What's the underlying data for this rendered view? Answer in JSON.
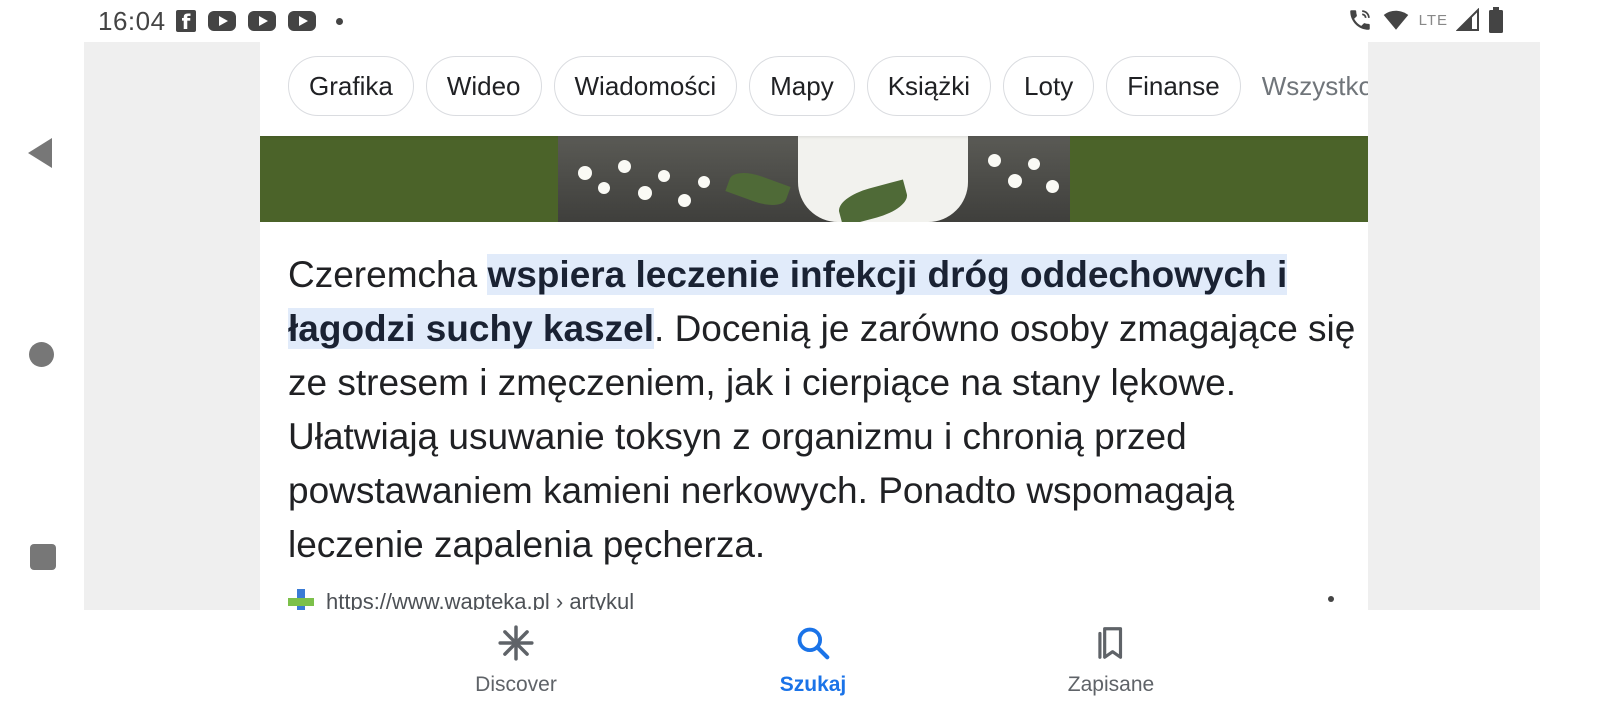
{
  "status_bar": {
    "time": "16:04",
    "left_icons": [
      "facebook-icon",
      "youtube-icon",
      "youtube-icon",
      "youtube-icon",
      "more-notifications-dot"
    ],
    "network_label": "LTE",
    "right_icons": [
      "wifi-calling-icon",
      "wifi-icon",
      "signal-icon",
      "battery-icon"
    ]
  },
  "search": {
    "chips": [
      "Grafika",
      "Wideo",
      "Wiadomości",
      "Mapy",
      "Książki",
      "Loty",
      "Finanse",
      "Wszystko"
    ]
  },
  "snippet": {
    "lead": "Czeremcha ",
    "highlight": "wspiera leczenie infekcji dróg oddechowych i łagodzi suchy kaszel",
    "rest": ". Docenią je zarówno osoby zmagające się ze stresem i zmęczeniem, jak i cierpiące na stany lękowe. Ułatwiają usuwanie toksyn z organizmu i chronią przed powstawaniem kamieni nerkowych. Ponadto wspomagają leczenie zapalenia pęcherza."
  },
  "source": {
    "url": "https://www.wapteka.pl › artykul"
  },
  "bottom_nav": {
    "items": [
      {
        "label": "Discover",
        "icon": "asterisk-icon",
        "active": false
      },
      {
        "label": "Szukaj",
        "icon": "search-icon",
        "active": true
      },
      {
        "label": "Zapisane",
        "icon": "bookmarks-icon",
        "active": false
      }
    ]
  },
  "colors": {
    "accent": "#1a73e8",
    "highlight_bg": "#e1ebfa",
    "image_band": "#4b6329"
  }
}
